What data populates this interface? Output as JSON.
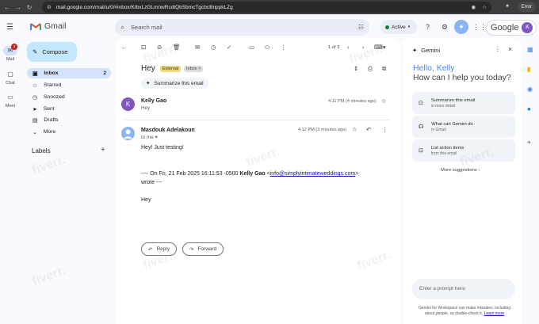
{
  "browser": {
    "url": "mail.google.com/mail/u/0/#inbox/KtbxLzGLmnwRcdtQbSbmcTgcbcBnppkLZg",
    "profile": "Error"
  },
  "gmail": {
    "brand": "Gmail",
    "search_placeholder": "Search mail",
    "status": "Active",
    "google_label": "Google",
    "avatar_letter": "K"
  },
  "rail": [
    {
      "label": "Mail",
      "badge": "3"
    },
    {
      "label": "Chat"
    },
    {
      "label": "Meet"
    }
  ],
  "compose_label": "Compose",
  "folders": [
    {
      "label": "Inbox",
      "count": "2"
    },
    {
      "label": "Starred"
    },
    {
      "label": "Snoozed"
    },
    {
      "label": "Sent"
    },
    {
      "label": "Drafts"
    },
    {
      "label": "More"
    }
  ],
  "labels_heading": "Labels",
  "thread": {
    "pager": "1 of 3",
    "subject": "Hey",
    "tag_external": "External",
    "tag_inbox": "Inbox",
    "summarize": "Summarize this email",
    "messages": [
      {
        "avatar": "K",
        "sender": "Kelly Gao",
        "snippet": "Hey",
        "time": "4:11 PM (4 minutes ago)"
      },
      {
        "sender": "Masdouk Adelakoun",
        "to": "to me",
        "time": "4:12 PM (3 minutes ago)"
      }
    ],
    "body": {
      "greeting": "Hey! Just testing!",
      "quote_prefix": "---- On Fri, 21 Feb 2025 16:11:53 -0500",
      "quote_name": "Kelly Gao",
      "quote_email": "info@simplyintimateweddings.com",
      "quote_suffix": "wrote ---",
      "quoted": "Hey"
    },
    "reply": "Reply",
    "forward": "Forward"
  },
  "gemini": {
    "title": "Gemini",
    "hello": "Hello, Kelly",
    "help": "How can I help you today?",
    "suggestions": [
      {
        "title": "Summarize this email",
        "sub": "in more detail"
      },
      {
        "title": "What can Gemini do",
        "sub": "in Gmail"
      },
      {
        "title": "List action items",
        "sub": "from this email"
      }
    ],
    "more": "More suggestions",
    "prompt": "Enter a prompt here",
    "disclaimer": "Gemini for Workspace can make mistakes, including about people, so double-check it.",
    "learn_more": "Learn more"
  },
  "watermark": "fiverr."
}
